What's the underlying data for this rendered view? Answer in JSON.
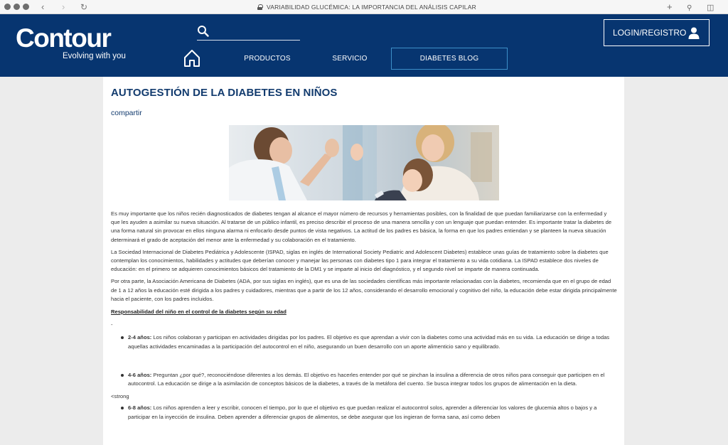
{
  "browser": {
    "url_title": "VARIABILIDAD GLUCÉMICA: LA IMPORTANCIA DEL ANÁLISIS CAPILAR",
    "icons": [
      "back-icon",
      "forward-icon",
      "reload-icon",
      "lock-icon",
      "new-tab-icon",
      "search-icon",
      "sidebar-icon"
    ]
  },
  "header": {
    "logo": "Contour",
    "tagline": "Evolving with you",
    "login_label": "LOGIN/REGISTRO",
    "nav": {
      "productos": "PRODUCTOS",
      "servicio": "SERVICIO",
      "blog": "DIABETES BLOG"
    },
    "colors": {
      "background": "#073570",
      "blog_border": "#3d8fc8"
    }
  },
  "article": {
    "title": "AUTOGESTIÓN DE LA DIABETES EN NIÑOS",
    "share": "compartir",
    "paragraphs": [
      "Es muy importante que los niños recién diagnosticados de diabetes tengan al alcance el mayor número de recursos y herramientas posibles, con la finalidad de que puedan familiarizarse con la enfermedad y que les ayuden a asimilar su nueva situación. Al tratarse de un público infantil, es preciso describir el proceso de una manera sencilla y con un lenguaje que puedan entender. Es importante tratar la diabetes de una forma natural sin provocar en ellos ninguna alarma ni enfocarlo desde puntos de vista negativos. La actitud de los padres es básica, la forma en que los padres entiendan y se planteen la nueva situación determinará el grado de aceptación del menor ante la enfermedad y su colaboración en el tratamiento.",
      "La Sociedad Internacional de Diabetes Pediátrica y Adolescente (ISPAD, siglas en inglés de International Society Pediatric and Adolescent Diabetes) establece unas guías de tratamiento sobre la diabetes que contemplan los conocimientos, habilidades y actitudes que deberían conocer y manejar las personas con diabetes tipo 1 para integrar el tratamiento a su vida cotidiana. La ISPAD establece dos niveles de educación: en el primero se adquieren conocimientos básicos del tratamiento de la DM1 y se imparte al inicio del diagnóstico, y el segundo nivel se imparte de manera continuada.",
      "Por otra parte, la Asociación Americana de Diabetes (ADA, por sus siglas en inglés), que es una de las sociedades científicas más importante relacionadas con la diabetes, recomienda que en el grupo de edad de 1 a 12 años la educación esté dirigida a los padres y cuidadores, mientras que a partir de los 12 años, considerando el desarrollo emocional y cognitivo del niño, la educación debe estar dirigida principalmente hacia el paciente, con los padres incluidos."
    ],
    "section_heading": "Responsabilidad del niño en el control de la diabetes según su edad",
    "dash": "-",
    "bullets": [
      {
        "label": "2-4 años:",
        "text": " Los niños colaboran y participan en actividades dirigidas por los padres. El objetivo es que aprendan a vivir con la diabetes como una actividad más en su vida. La educación se dirige a todas aquellas actividades encaminadas a la participación del autocontrol en el niño, asegurando un buen desarrollo con un aporte alimenticio sano y equilibrado."
      },
      {
        "label": "4-6 años:",
        "text": " Preguntan ¿por qué?, reconociéndose diferentes a los demás. El objetivo es hacerles entender por qué se pinchan la insulina a diferencia de otros niños para conseguir que participen en el autocontrol. La educación se dirige a la asimilación de conceptos básicos de la diabetes, a través de la metáfora del cuento. Se busca integrar todos los grupos de alimentación en la dieta."
      },
      {
        "label": "6-8 años:",
        "text": " Los niños aprenden a leer y escribir, conocen el tiempo, por lo que el objetivo es que puedan realizar el autocontrol solos, aprender a diferenciar los valores de glucemia altos o bajos y a participar en la inyección de insulina. Deben aprender a diferenciar grupos de alimentos, se debe asegurar que los ingieran de forma sana, así como deben"
      }
    ],
    "strong_tag": "<strong"
  }
}
